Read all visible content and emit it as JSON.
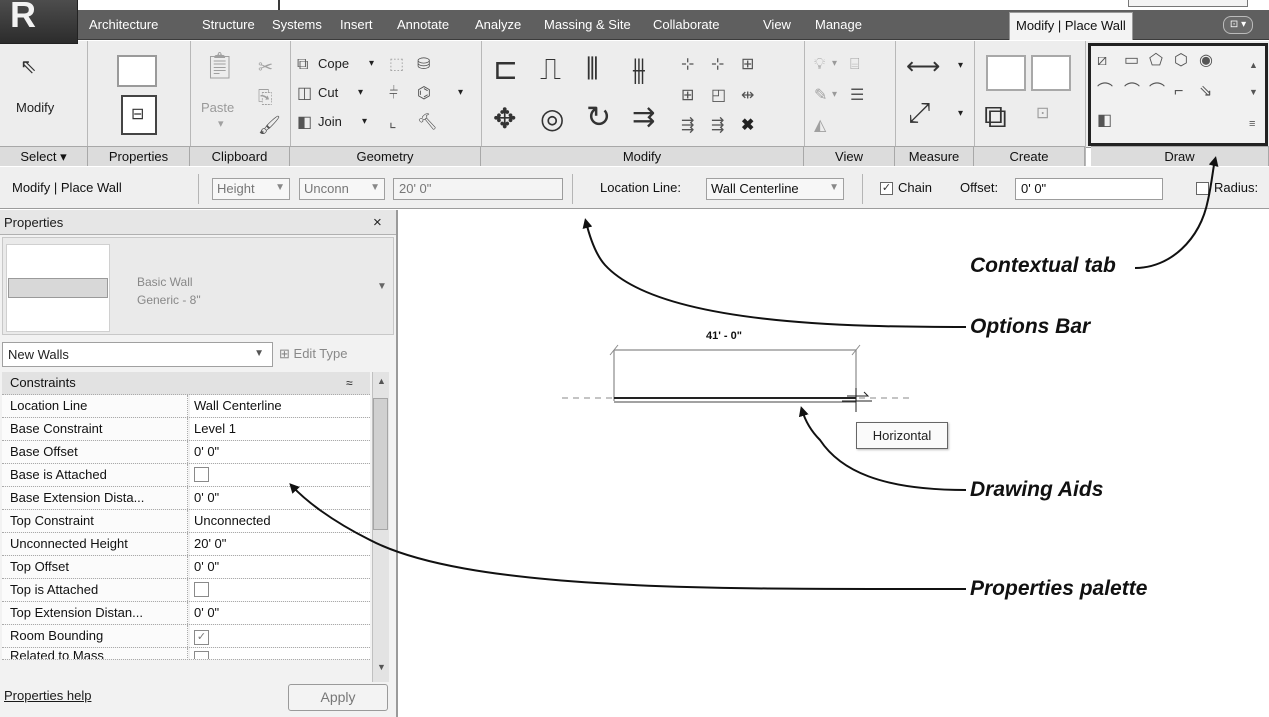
{
  "app": {
    "menu_glyph": "R"
  },
  "tabs": [
    {
      "label": "Architecture"
    },
    {
      "label": "Structure"
    },
    {
      "label": "Systems"
    },
    {
      "label": "Insert"
    },
    {
      "label": "Annotate"
    },
    {
      "label": "Analyze"
    },
    {
      "label": "Massing & Site"
    },
    {
      "label": "Collaborate"
    },
    {
      "label": "View"
    },
    {
      "label": "Manage"
    },
    {
      "label": "Modify | Place Wall",
      "active": true
    }
  ],
  "tab_dropdown": "⊡ ▾",
  "ribbon": {
    "select": {
      "button": "Modify",
      "panel": "Select ▾"
    },
    "properties": {
      "panel": "Properties"
    },
    "clipboard": {
      "paste": "Paste",
      "panel": "Clipboard"
    },
    "geometry": {
      "cope": "Cope",
      "cut": "Cut",
      "join": "Join",
      "panel": "Geometry"
    },
    "modify": {
      "panel": "Modify"
    },
    "view": {
      "panel": "View"
    },
    "measure": {
      "panel": "Measure"
    },
    "create": {
      "panel": "Create"
    },
    "draw": {
      "panel": "Draw"
    }
  },
  "options_bar": {
    "context": "Modify | Place Wall",
    "height_mode": "Height",
    "top_constraint": "Unconn",
    "height_value": "20'  0\"",
    "location_line_label": "Location Line:",
    "location_line_value": "Wall Centerline",
    "chain_label": "Chain",
    "chain_checked": true,
    "offset_label": "Offset:",
    "offset_value": "0'  0\"",
    "radius_label": "Radius:",
    "radius_checked": false
  },
  "properties": {
    "title": "Properties",
    "close": "×",
    "type_family": "Basic Wall",
    "type_name": "Generic - 8\"",
    "instance_filter": "New Walls",
    "edit_type": "Edit Type",
    "category": "Constraints",
    "category_toggle": "≈",
    "rows": [
      {
        "key": "Location Line",
        "value": "Wall Centerline"
      },
      {
        "key": "Base Constraint",
        "value": "Level 1"
      },
      {
        "key": "Base Offset",
        "value": "0'  0\""
      },
      {
        "key": "Base is Attached",
        "value": "",
        "checkbox": true
      },
      {
        "key": "Base Extension Dista...",
        "value": "0'  0\""
      },
      {
        "key": "Top Constraint",
        "value": "Unconnected"
      },
      {
        "key": "Unconnected Height",
        "value": "20'  0\""
      },
      {
        "key": "Top Offset",
        "value": "0'  0\""
      },
      {
        "key": "Top is Attached",
        "value": "",
        "checkbox": true
      },
      {
        "key": "Top Extension Distan...",
        "value": "0'  0\""
      },
      {
        "key": "Room Bounding",
        "value": "",
        "checkbox": true,
        "checked": true
      },
      {
        "key": "Related to Mass",
        "value": "",
        "checkbox": true
      }
    ],
    "help": "Properties help",
    "apply": "Apply"
  },
  "canvas": {
    "dimension": "41' - 0\"",
    "tooltip": "Horizontal"
  },
  "callouts": {
    "contextual_tab": "Contextual tab",
    "options_bar": "Options Bar",
    "drawing_aids": "Drawing Aids",
    "properties_palette": "Properties palette"
  },
  "colors": {
    "tab_bar": "#5f5f5f",
    "ribbon": "#ededed",
    "panel_label": "#dcdcdc"
  }
}
